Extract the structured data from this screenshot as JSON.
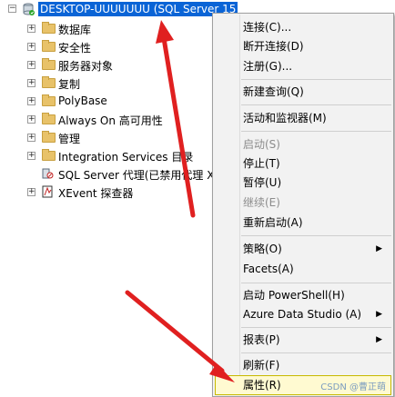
{
  "tree": {
    "root_label": "DESKTOP-UUUUUUU (SQL Server 15",
    "items": [
      {
        "label": "数据库",
        "icon": "folder"
      },
      {
        "label": "安全性",
        "icon": "folder"
      },
      {
        "label": "服务器对象",
        "icon": "folder"
      },
      {
        "label": "复制",
        "icon": "folder"
      },
      {
        "label": "PolyBase",
        "icon": "folder"
      },
      {
        "label": "Always On 高可用性",
        "icon": "folder"
      },
      {
        "label": "管理",
        "icon": "folder"
      },
      {
        "label": "Integration Services 目录",
        "icon": "folder"
      },
      {
        "label": "SQL Server 代理(已禁用代理 X",
        "icon": "sql-agent-icon"
      },
      {
        "label": "XEvent 探查器",
        "icon": "xevent-icon"
      }
    ]
  },
  "menu": {
    "items": [
      {
        "label": "连接(C)..."
      },
      {
        "label": "断开连接(D)"
      },
      {
        "label": "注册(G)..."
      },
      {
        "label": "新建查询(Q)"
      },
      {
        "label": "活动和监视器(M)"
      },
      {
        "label": "启动(S)"
      },
      {
        "label": "停止(T)"
      },
      {
        "label": "暂停(U)"
      },
      {
        "label": "继续(E)"
      },
      {
        "label": "重新启动(A)"
      },
      {
        "label": "策略(O)"
      },
      {
        "label": "Facets(A)"
      },
      {
        "label": "启动 PowerShell(H)"
      },
      {
        "label": "Azure Data Studio (A)"
      },
      {
        "label": "报表(P)"
      },
      {
        "label": "刷新(F)"
      },
      {
        "label": "属性(R)"
      }
    ]
  },
  "watermark": "CSDN @曹正萌",
  "colors": {
    "selection": "#0a64d6",
    "arrow": "#e02020",
    "highlight": "#fffad1"
  }
}
